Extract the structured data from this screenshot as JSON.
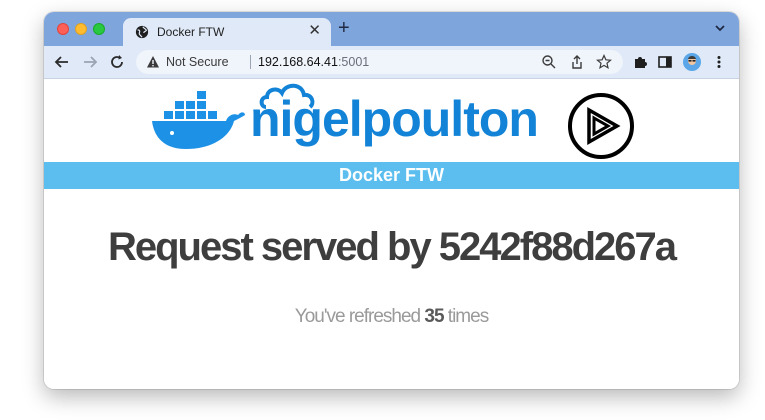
{
  "browser": {
    "tab": {
      "title": "Docker FTW",
      "favicon": "globe-icon"
    },
    "address_bar": {
      "security_label": "Not Secure",
      "host": "192.168.64.41",
      "port": ":5001"
    }
  },
  "page": {
    "logos": [
      "docker-whale-logo",
      "nigelpoulton-logo",
      "pluralsight-logo"
    ],
    "brand_text": "nigelpoulton",
    "banner_title": "Docker FTW",
    "request_line": "Request served by 5242f88d267a",
    "refresh": {
      "prefix": "You've refreshed ",
      "count": "35",
      "suffix": " times"
    }
  },
  "colors": {
    "tab_strip": "#7ea5dc",
    "toolbar": "#dfe9f7",
    "banner": "#5bbeee",
    "brand_blue": "#1283d6",
    "docker_blue": "#1d91e6"
  }
}
